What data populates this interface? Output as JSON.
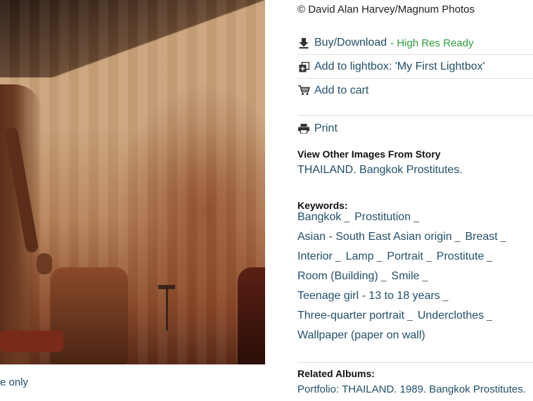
{
  "photo": {
    "caption_fragment": "e only"
  },
  "info": {
    "credit": "© David Alan Harvey/Magnum Photos",
    "actions": {
      "buy_label": "Buy/Download",
      "buy_status": "- High Res Ready",
      "lightbox_label": "Add to lightbox: 'My First Lightbox'",
      "cart_label": "Add to cart",
      "print_label": "Print"
    },
    "story": {
      "heading": "View Other Images From Story",
      "link": "THAILAND. Bangkok Prostitutes."
    },
    "keywords": {
      "heading": "Keywords:",
      "separator": "_",
      "rows": [
        [
          "Bangkok",
          "Prostitution"
        ],
        [
          "Asian - South East Asian origin",
          "Breast"
        ],
        [
          "Interior",
          "Lamp",
          "Portrait",
          "Prostitute"
        ],
        [
          "Room (Building)",
          "Smile"
        ],
        [
          "Teenage girl - 13 to 18 years"
        ],
        [
          "Three-quarter portrait",
          "Underclothes"
        ],
        [
          "Wallpaper (paper on wall)"
        ]
      ]
    },
    "albums": {
      "heading": "Related Albums:",
      "link": "Portfolio: THAILAND. 1989. Bangkok Prostitutes."
    }
  },
  "colors": {
    "link": "#24506a",
    "ready": "#2e9e3e",
    "divider": "#dddddd"
  },
  "icons": [
    "download-icon",
    "lightbox-icon",
    "cart-icon",
    "print-icon"
  ]
}
